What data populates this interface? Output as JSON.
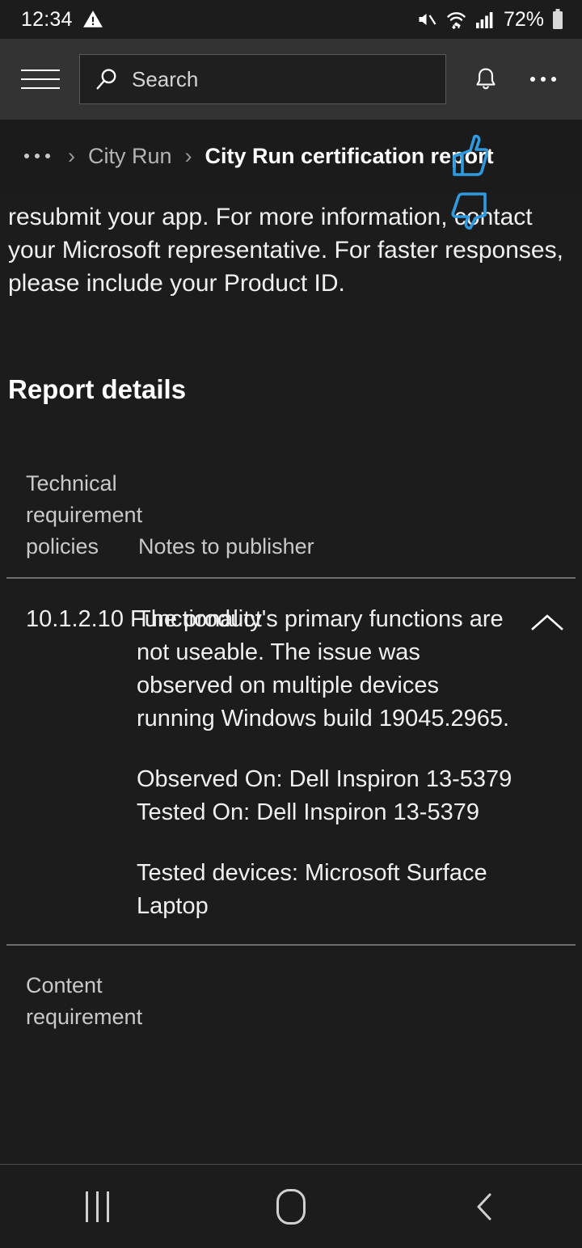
{
  "status_bar": {
    "time": "12:34",
    "battery_percent": "72%",
    "icons": [
      "warning-triangle-icon",
      "mute-icon",
      "wifi-icon",
      "cellular-signal-icon",
      "battery-icon"
    ]
  },
  "app_bar": {
    "menu_icon": "hamburger-menu-icon",
    "search_placeholder": "Search",
    "search_value": "",
    "search_icon": "search-icon",
    "notifications_icon": "bell-icon",
    "more_icon": "more-options-icon"
  },
  "breadcrumb": {
    "overflow": "...",
    "separator": "›",
    "items": [
      {
        "label": "City Run",
        "current": false
      },
      {
        "label": "City Run certification report",
        "current": true
      }
    ]
  },
  "feedback": {
    "like_icon": "thumbs-up-icon",
    "dislike_icon": "thumbs-down-icon",
    "color": "#2f9ae0"
  },
  "main": {
    "paragraph": "resubmit your app. For more information, contact your Microsoft representative. For faster responses, please include your Product ID.",
    "section_heading": "Report details",
    "table": {
      "headers": {
        "policies": "Technical requirement policies",
        "notes": "Notes to publisher"
      },
      "rows": [
        {
          "policy": "10.1.2.10 Functionality",
          "notes": [
            "The product's primary functions are not useable. The issue was observed on multiple devices running Windows build 19045.2965.",
            "Observed On: Dell Inspiron 13-5379\nTested On: Dell Inspiron 13-5379",
            "Tested devices: Microsoft Surface Laptop"
          ],
          "expanded": true,
          "toggle_icon": "chevron-up-icon"
        },
        {
          "policy": "Content requirement",
          "notes": [],
          "expanded": false,
          "toggle_icon": "chevron-down-icon"
        }
      ]
    }
  },
  "nav_bar": {
    "recents_icon": "recent-apps-icon",
    "home_icon": "home-icon",
    "back_icon": "back-icon"
  }
}
